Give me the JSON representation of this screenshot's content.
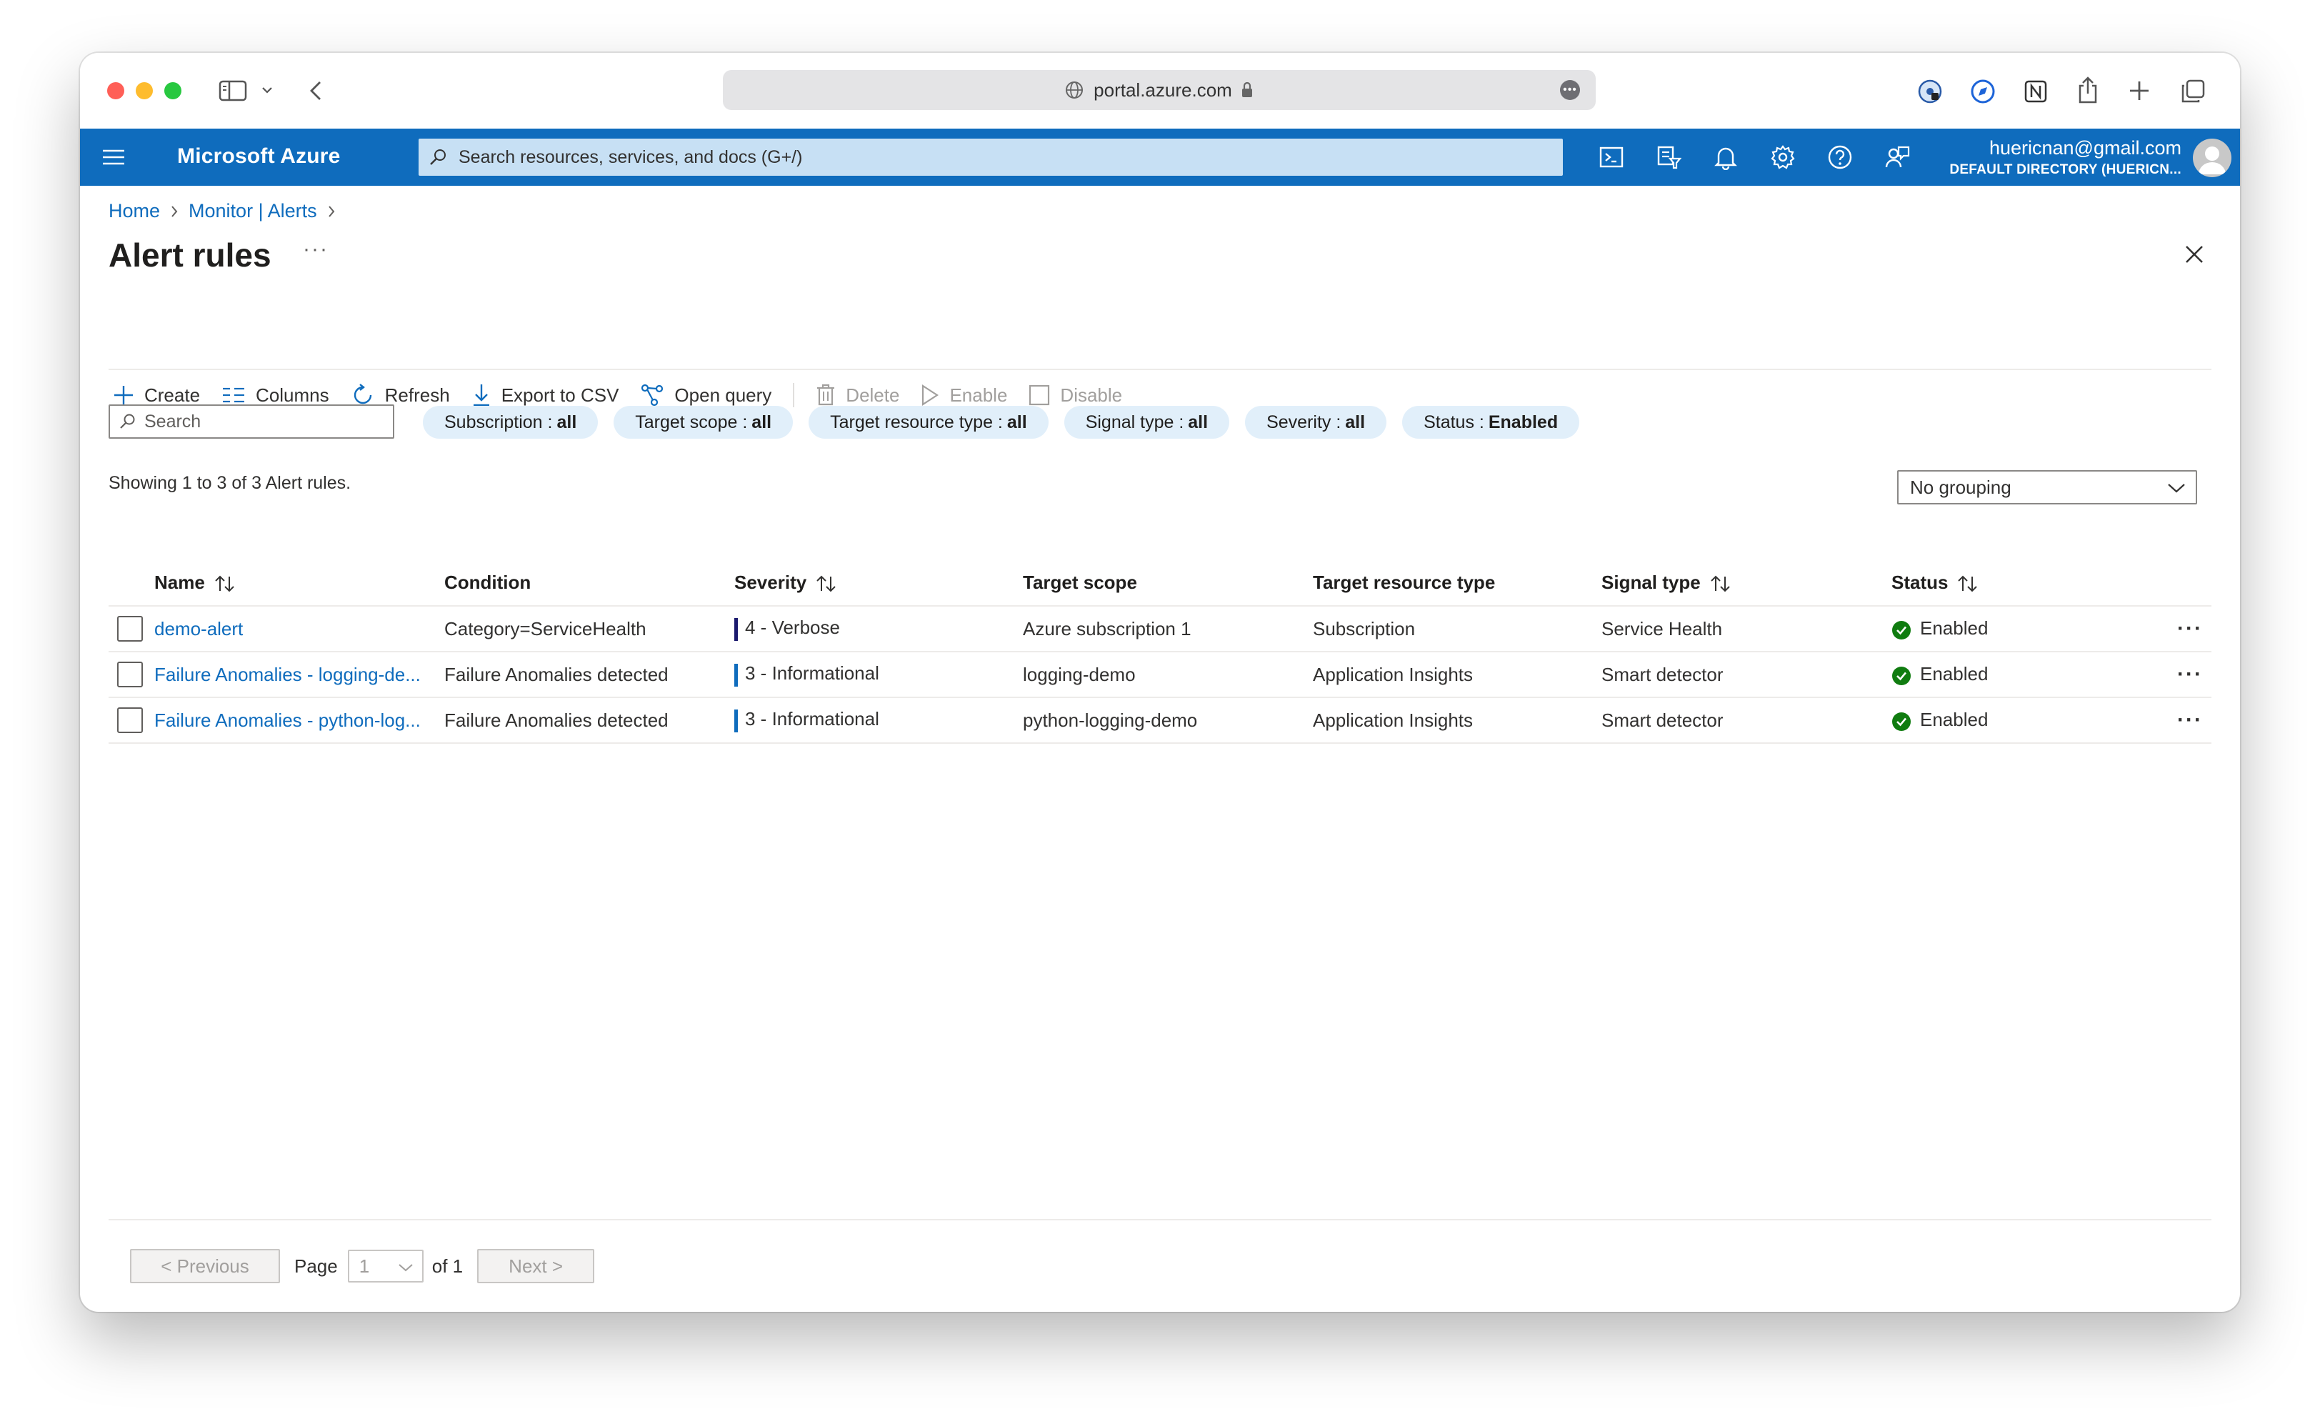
{
  "browser": {
    "url": "portal.azure.com"
  },
  "azure": {
    "brand": "Microsoft Azure",
    "search_placeholder": "Search resources, services, and docs (G+/)",
    "user_email": "huericnan@gmail.com",
    "user_directory": "DEFAULT DIRECTORY (HUERICN..."
  },
  "breadcrumb": {
    "items": [
      "Home",
      "Monitor | Alerts"
    ]
  },
  "page": {
    "title": "Alert rules",
    "more": "···"
  },
  "toolbar": {
    "create": "Create",
    "columns": "Columns",
    "refresh": "Refresh",
    "export": "Export to CSV",
    "open_query": "Open query",
    "delete": "Delete",
    "enable": "Enable",
    "disable": "Disable"
  },
  "filters": {
    "search_placeholder": "Search",
    "pills": [
      {
        "label": "Subscription : ",
        "value": "all"
      },
      {
        "label": "Target scope : ",
        "value": "all"
      },
      {
        "label": "Target resource type : ",
        "value": "all"
      },
      {
        "label": "Signal type : ",
        "value": "all"
      },
      {
        "label": "Severity : ",
        "value": "all"
      },
      {
        "label": "Status : ",
        "value": "Enabled"
      }
    ]
  },
  "summary": "Showing 1 to 3 of 3 Alert rules.",
  "grouping": "No grouping",
  "table": {
    "headers": [
      "Name",
      "Condition",
      "Severity",
      "Target scope",
      "Target resource type",
      "Signal type",
      "Status"
    ],
    "rows": [
      {
        "name": "demo-alert",
        "condition": "Category=ServiceHealth",
        "severity": "4 - Verbose",
        "scope": "Azure subscription 1",
        "resource_type": "Subscription",
        "signal": "Service Health",
        "status": "Enabled"
      },
      {
        "name": "Failure Anomalies - logging-de...",
        "condition": "Failure Anomalies detected",
        "severity": "3 - Informational",
        "scope": "logging-demo",
        "resource_type": "Application Insights",
        "signal": "Smart detector",
        "status": "Enabled"
      },
      {
        "name": "Failure Anomalies - python-log...",
        "condition": "Failure Anomalies detected",
        "severity": "3 - Informational",
        "scope": "python-logging-demo",
        "resource_type": "Application Insights",
        "signal": "Smart detector",
        "status": "Enabled"
      }
    ],
    "row_more": "···"
  },
  "pager": {
    "previous": "< Previous",
    "page_label": "Page",
    "page_value": "1",
    "of_label": "of 1",
    "next": "Next >"
  },
  "colors": {
    "azure_blue": "#0f6cbd",
    "pill_bg": "#e1effa",
    "enabled_green": "#107c10",
    "sev4": "#1b1a6e",
    "sev3": "#0f6cbd"
  }
}
